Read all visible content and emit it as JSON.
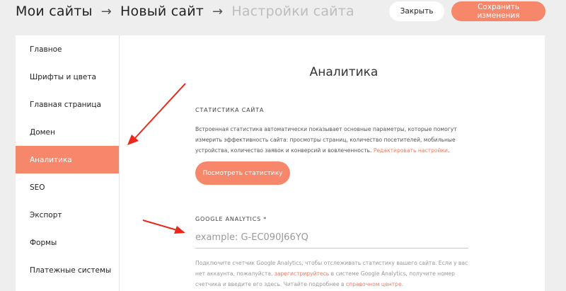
{
  "breadcrumb": {
    "sites": "Мои сайты",
    "new_site": "Новый сайт",
    "current": "Настройки сайта",
    "separator": "→"
  },
  "toolbar": {
    "close_label": "Закрыть",
    "save_label": "Сохранить изменения"
  },
  "sidebar": {
    "items": [
      {
        "label": "Главное"
      },
      {
        "label": "Шрифты и цвета"
      },
      {
        "label": "Главная страница"
      },
      {
        "label": "Домен"
      },
      {
        "label": "Аналитика",
        "active": true
      },
      {
        "label": "SEO"
      },
      {
        "label": "Экспорт"
      },
      {
        "label": "Формы"
      },
      {
        "label": "Платежные системы"
      }
    ]
  },
  "main": {
    "title": "Аналитика",
    "stats": {
      "label": "СТАТИСТИКА САЙТА",
      "description": "Встроенная статистика автоматически показывает основные параметры, которые помогут измерить эффективность сайта: просмотры страниц, количество посетителей, мобильные устройства, количество заявок и конверсий и вовлеченность.",
      "link": "Редактировать настройки",
      "link_suffix": ".",
      "button": "Посмотреть статистику"
    },
    "ga": {
      "label": "GOOGLE ANALYTICS *",
      "placeholder": "example: G-EC090J66YQ",
      "value": "",
      "help_part1": "Подключите счетчик Google Analytics, чтобы отслеживать статистику вашего сайта. Если у вас нет аккаунта, пожалуйста, ",
      "help_link1": "зарегистрируйтесь",
      "help_part2": " в системе Google Analytics, получите номер счетчика и введите его здесь. Читайте подробнее в ",
      "help_link2": "справочном центре",
      "help_part3": "."
    }
  },
  "colors": {
    "accent": "#f6876b",
    "link": "#f07a60",
    "annotation_arrow": "#e8291c",
    "background": "#eeeeee"
  }
}
